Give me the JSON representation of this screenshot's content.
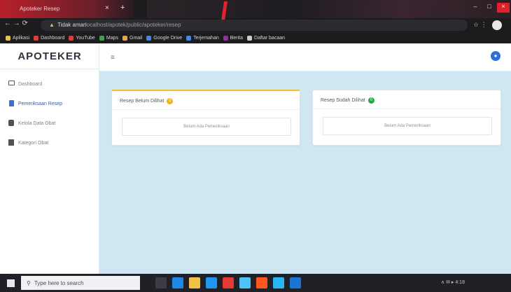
{
  "browser": {
    "tab_title": "Apoteker Resep",
    "tab_close": "×",
    "tab_new": "+",
    "nav_glyphs": "← → ⟳",
    "security_label": "Tidak aman",
    "url": "localhost/apotek/public/apoteker/resep",
    "omni_right_glyphs": "☆ ⋮",
    "window_controls": [
      "–",
      "□",
      "×"
    ],
    "bookmarks": [
      {
        "label": "Aplikasi",
        "color": "#e8c34a"
      },
      {
        "label": "Dashboard",
        "color": "#e53935"
      },
      {
        "label": "YouTube",
        "color": "#e53935"
      },
      {
        "label": "Maps",
        "color": "#43a047"
      },
      {
        "label": "Gmail",
        "color": "#f0a53b"
      },
      {
        "label": "Google Drive",
        "color": "#3c8ce7"
      },
      {
        "label": "Terjemahan",
        "color": "#3c8ce7"
      },
      {
        "label": "Berita",
        "color": "#9c27b0"
      },
      {
        "label": "Daftar bacaan",
        "color": "#cccccc"
      }
    ]
  },
  "app": {
    "brand": "APOTEKER",
    "sidebar": {
      "items": [
        {
          "label": "Dashboard",
          "icon": "monitor-icon"
        },
        {
          "label": "Pemeriksaan Resep",
          "icon": "file-icon",
          "active": true
        },
        {
          "label": "Kelola Data Obat",
          "icon": "database-icon"
        },
        {
          "label": "Kategori Obat",
          "icon": "grid-icon"
        }
      ]
    },
    "topbar": {
      "menu_glyph": "≡",
      "user_glyph": "●"
    },
    "cards": [
      {
        "title": "Resep Belum Dilihat",
        "badge": "0",
        "empty_text": "Belum Ada Pemeriksaan"
      },
      {
        "title": "Resep Sudah Dilihat",
        "badge": "0",
        "empty_text": "Belum Ada Pemeriksaan"
      }
    ]
  },
  "taskbar": {
    "search_placeholder": "Type here to search",
    "clock": "∧ ✉ ▸ 4:18",
    "icon_colors": [
      "#3c3c44",
      "#1e88e5",
      "#f2c046",
      "#2196f3",
      "#e53935",
      "#4fc3f7",
      "#ff5722",
      "#29b6f6",
      "#1976d2"
    ]
  },
  "colors": {
    "content_bg": "#cfe6f3",
    "accent_blue": "#2f6ee0",
    "warn": "#f2b21b",
    "ok": "#28a745"
  }
}
